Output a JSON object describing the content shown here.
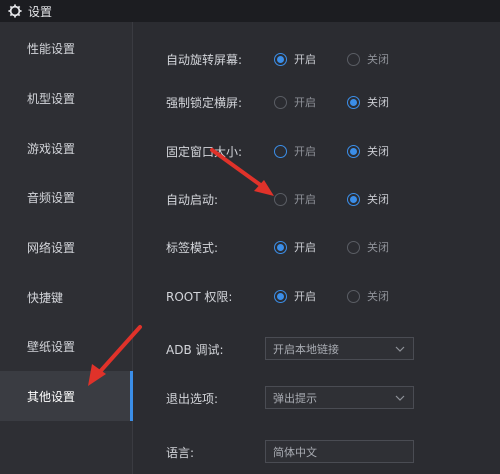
{
  "window": {
    "title": "设置"
  },
  "sidebar": {
    "items": [
      {
        "label": "性能设置"
      },
      {
        "label": "机型设置"
      },
      {
        "label": "游戏设置"
      },
      {
        "label": "音频设置"
      },
      {
        "label": "网络设置"
      },
      {
        "label": "快捷键"
      },
      {
        "label": "壁纸设置"
      },
      {
        "label": "其他设置",
        "active": true
      }
    ]
  },
  "settings": {
    "auto_rotate": {
      "label": "自动旋转屏幕:",
      "on": "开启",
      "off": "关闭",
      "value": "开启"
    },
    "force_landscape": {
      "label": "强制锁定横屏:",
      "on": "开启",
      "off": "关闭",
      "value": "关闭"
    },
    "fixed_window": {
      "label": "固定窗口大小:",
      "on": "开启",
      "off": "关闭",
      "value": "关闭"
    },
    "auto_start": {
      "label": "自动启动:",
      "on": "开启",
      "off": "关闭",
      "value": "关闭"
    },
    "tab_mode": {
      "label": "标签模式:",
      "on": "开启",
      "off": "关闭",
      "value": "开启"
    },
    "root": {
      "label": "ROOT 权限:",
      "on": "开启",
      "off": "关闭",
      "value": "开启"
    },
    "adb": {
      "label": "ADB 调试:",
      "value": "开启本地链接"
    },
    "exit": {
      "label": "退出选项:",
      "value": "弹出提示"
    },
    "language": {
      "label": "语言:",
      "value": "简体中文"
    }
  },
  "colors": {
    "accent": "#3b8ee8",
    "annotation": "#e0322a"
  }
}
